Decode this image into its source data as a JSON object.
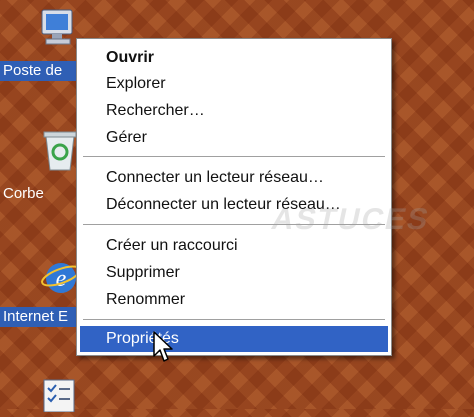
{
  "desktop": {
    "icons": [
      {
        "label": "Poste de",
        "icon": "my-computer-icon",
        "selected": true
      },
      {
        "label": "Corbe",
        "icon": "recycle-bin-icon",
        "selected": false
      },
      {
        "label": "Internet E",
        "icon": "internet-explorer-icon",
        "selected": true
      },
      {
        "label": "",
        "icon": "checklist-icon",
        "selected": false
      }
    ]
  },
  "context_menu": {
    "items": [
      {
        "label": "Ouvrir"
      },
      {
        "label": "Explorer"
      },
      {
        "label": "Rechercher…"
      },
      {
        "label": "Gérer"
      },
      {
        "label": "Connecter un lecteur réseau…"
      },
      {
        "label": "Déconnecter un lecteur réseau…"
      },
      {
        "label": "Créer un raccourci"
      },
      {
        "label": "Supprimer"
      },
      {
        "label": "Renommer"
      },
      {
        "label": "Propriétés"
      }
    ],
    "default_item": "Ouvrir",
    "highlighted_item": "Propriétés"
  },
  "watermark": {
    "text": "ASTUCES"
  },
  "cursor": {
    "icon": "mouse-pointer-icon"
  },
  "colors": {
    "selection": "#3163c5",
    "desktop": "#9c4a21"
  }
}
